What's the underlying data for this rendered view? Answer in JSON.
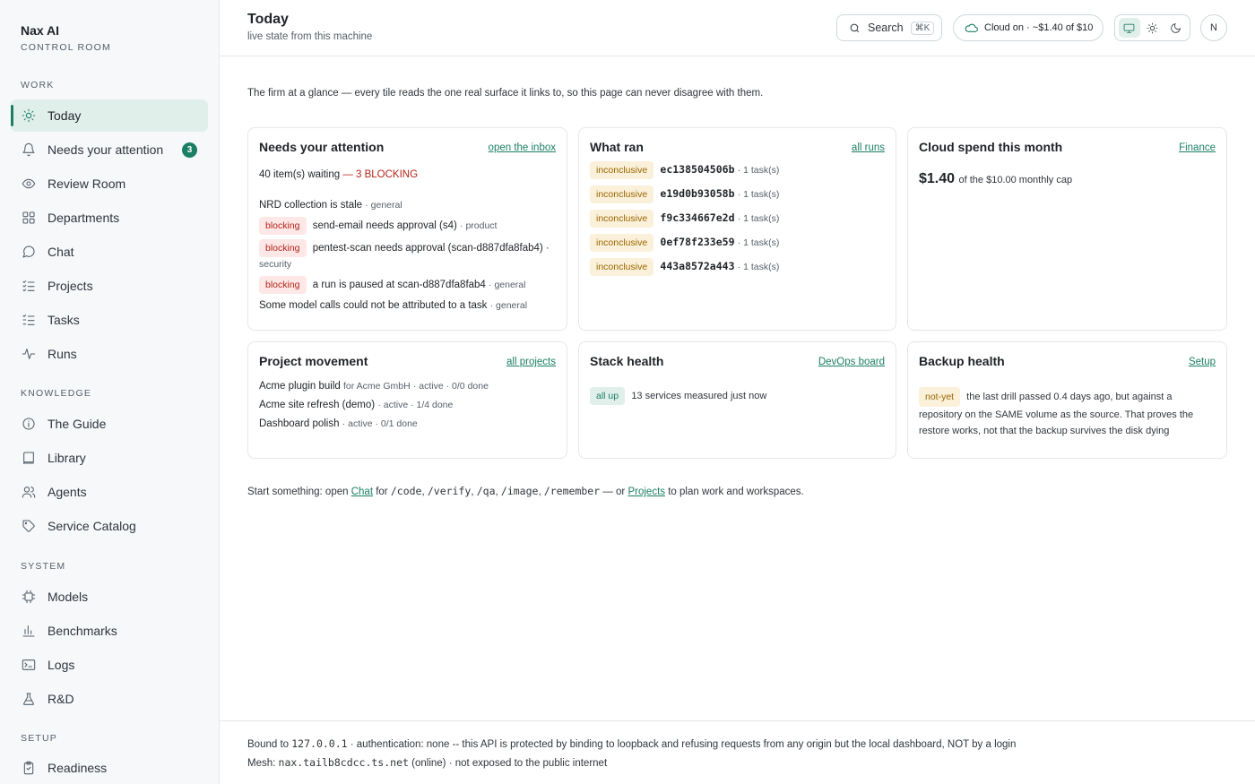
{
  "brand": {
    "name": "Nax AI",
    "subtitle": "CONTROL ROOM"
  },
  "sidebar": {
    "sections": {
      "work": "WORK",
      "knowledge": "KNOWLEDGE",
      "system": "SYSTEM",
      "setup": "SETUP"
    },
    "items": [
      {
        "label": "Today",
        "icon": "sun-icon"
      },
      {
        "label": "Needs your attention",
        "icon": "bell-icon",
        "badge": "3"
      },
      {
        "label": "Review Room",
        "icon": "eye-icon"
      },
      {
        "label": "Departments",
        "icon": "grid-icon"
      },
      {
        "label": "Chat",
        "icon": "chat-icon"
      },
      {
        "label": "Projects",
        "icon": "list-check-icon"
      },
      {
        "label": "Tasks",
        "icon": "list-icon"
      },
      {
        "label": "Runs",
        "icon": "pulse-icon"
      },
      {
        "label": "The Guide",
        "icon": "info-icon"
      },
      {
        "label": "Library",
        "icon": "book-icon"
      },
      {
        "label": "Agents",
        "icon": "users-icon"
      },
      {
        "label": "Service Catalog",
        "icon": "tag-icon"
      },
      {
        "label": "Models",
        "icon": "chip-icon"
      },
      {
        "label": "Benchmarks",
        "icon": "bar-chart-icon"
      },
      {
        "label": "Logs",
        "icon": "terminal-icon"
      },
      {
        "label": "R&D",
        "icon": "flask-icon"
      },
      {
        "label": "Readiness",
        "icon": "clipboard-icon"
      }
    ]
  },
  "header": {
    "title": "Today",
    "subtitle": "live state from this machine",
    "search_label": "Search",
    "search_kbd": "⌘K",
    "cloud_status": "Cloud on · ~$1.40 of $10",
    "avatar_initial": "N"
  },
  "intro": "The firm at a glance — every tile reads the one real surface it links to, so this page can never disagree with them.",
  "cards": {
    "attention": {
      "title": "Needs your attention",
      "link": "open the inbox",
      "waiting": "40 item(s) waiting",
      "blocking_count": "— 3 BLOCKING",
      "items": [
        {
          "tag": "",
          "text": "NRD collection is stale",
          "meta": "· general"
        },
        {
          "tag": "blocking",
          "text": "send-email needs approval (s4)",
          "meta": "· product"
        },
        {
          "tag": "blocking",
          "text": "pentest-scan needs approval (scan-d887dfa8fab4) ·",
          "meta": "security"
        },
        {
          "tag": "blocking",
          "text": "a run is paused at scan-d887dfa8fab4",
          "meta": "· general"
        },
        {
          "tag": "",
          "text": "Some model calls could not be attributed to a task",
          "meta": "· general"
        }
      ]
    },
    "runs": {
      "title": "What ran",
      "link": "all runs",
      "items": [
        {
          "status": "inconclusive",
          "id": "ec138504506b",
          "meta": "· 1 task(s)"
        },
        {
          "status": "inconclusive",
          "id": "e19d0b93058b",
          "meta": "· 1 task(s)"
        },
        {
          "status": "inconclusive",
          "id": "f9c334667e2d",
          "meta": "· 1 task(s)"
        },
        {
          "status": "inconclusive",
          "id": "0ef78f233e59",
          "meta": "· 1 task(s)"
        },
        {
          "status": "inconclusive",
          "id": "443a8572a443",
          "meta": "· 1 task(s)"
        }
      ]
    },
    "spend": {
      "title": "Cloud spend this month",
      "link": "Finance",
      "amount": "$1.40",
      "cap": "of the $10.00 monthly cap"
    },
    "projects": {
      "title": "Project movement",
      "link": "all projects",
      "items": [
        {
          "name": "Acme plugin build",
          "client": "for Acme GmbH",
          "meta": "· active · 0/0 done"
        },
        {
          "name": "Acme site refresh (demo)",
          "client": "",
          "meta": "· active · 1/4 done"
        },
        {
          "name": "Dashboard polish",
          "client": "",
          "meta": "· active · 0/1 done"
        }
      ]
    },
    "stack": {
      "title": "Stack health",
      "link": "DevOps board",
      "status": "all up",
      "text": "13 services measured just now"
    },
    "backup": {
      "title": "Backup health",
      "link": "Setup",
      "status": "not-yet",
      "text": "the last drill passed 0.4 days ago, but against a repository on the SAME volume as the source. That proves the restore works, not that the backup survives the disk dying"
    }
  },
  "start": {
    "prefix": "Start something: open",
    "chat_link": "Chat",
    "for": "for",
    "cmds": [
      "/code",
      "/verify",
      "/qa",
      "/image",
      "/remember"
    ],
    "or": "— or",
    "projects_link": "Projects",
    "suffix": "to plan work and workspaces."
  },
  "footer": {
    "line1_prefix": "Bound to",
    "bind_addr": "127.0.0.1",
    "line1_suffix": "· authentication: none -- this API is protected by binding to loopback and refusing requests from any origin but the local dashboard, NOT by a login",
    "line2_prefix": "Mesh:",
    "mesh_host": "nax.tailb8cdcc.ts.net",
    "line2_suffix": "(online) · not exposed to the public internet"
  }
}
